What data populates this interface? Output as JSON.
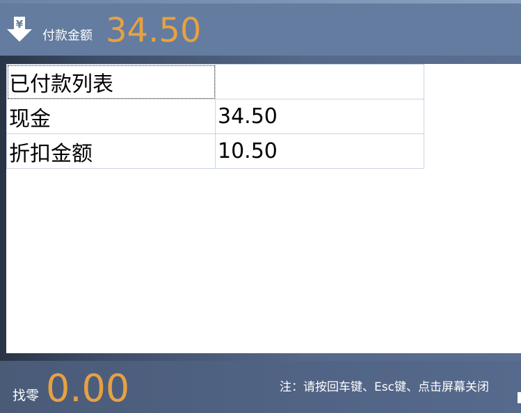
{
  "header": {
    "icon": "yen-download-arrow-icon",
    "icon_glyph": "¥",
    "amount_label": "付款金额",
    "amount_value": "34.50"
  },
  "payments": {
    "header_label": "已付款列表",
    "rows": [
      {
        "method": "现金",
        "amount": "34.50"
      },
      {
        "method": "折扣金额",
        "amount": "10.50"
      }
    ]
  },
  "footer": {
    "change_label": "找零",
    "change_value": "0.00",
    "note": "注：请按回车键、Esc键、点击屏幕关闭"
  },
  "colors": {
    "accent_amount": "#e7a142",
    "header_bg": "#637c9f",
    "footer_bg": "#566a8d"
  }
}
